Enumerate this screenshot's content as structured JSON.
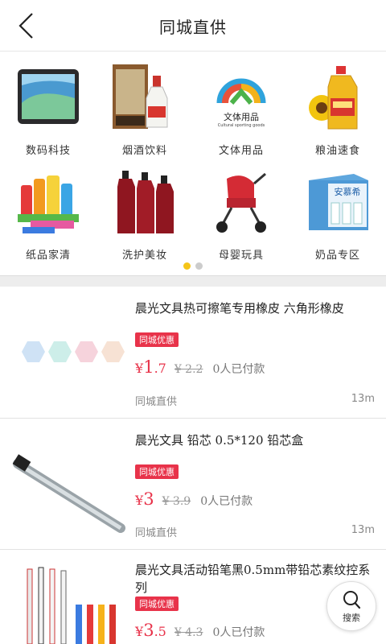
{
  "header": {
    "title": "同城直供",
    "back_icon": "chevron-left-icon"
  },
  "categories": [
    {
      "label": "数码科技",
      "icon": "smartphone-image"
    },
    {
      "label": "烟酒饮料",
      "icon": "liquor-bottle-image"
    },
    {
      "label": "文体用品",
      "icon": "stationery-logo-image",
      "logo_text": "文体用品",
      "logo_sub": "Cultural sporting goods"
    },
    {
      "label": "粮油速食",
      "icon": "cooking-oil-image"
    },
    {
      "label": "纸品家清",
      "icon": "cleaning-supplies-image"
    },
    {
      "label": "洗护美妆",
      "icon": "shampoo-bottles-image"
    },
    {
      "label": "母婴玩具",
      "icon": "baby-stroller-image"
    },
    {
      "label": "奶品专区",
      "icon": "milk-box-image",
      "box_text": "安慕希"
    }
  ],
  "pager": {
    "pages": 2,
    "active": 1,
    "active_color": "#f5c518"
  },
  "products": [
    {
      "title": "晨光文具热可擦笔专用橡皮 六角形橡皮",
      "badge": "同城优惠",
      "price_currency": "¥",
      "price_int": "1",
      "price_dec": ".7",
      "old_price": "¥ 2.2",
      "paid": "0人已付款",
      "shop": "同城直供",
      "distance": "13m",
      "image": "hexagon-erasers-image"
    },
    {
      "title": "晨光文具 铅芯 0.5*120 铅芯盒",
      "badge": "同城优惠",
      "price_currency": "¥",
      "price_int": "3",
      "price_dec": "",
      "old_price": "¥ 3.9",
      "paid": "0人已付款",
      "shop": "同城直供",
      "distance": "13m",
      "image": "pencil-lead-tube-image"
    },
    {
      "title": "晨光文具活动铅笔黑0.5mm带铅芯素纹控系列",
      "badge": "同城优惠",
      "price_currency": "¥",
      "price_int": "3",
      "price_dec": ".5",
      "old_price": "¥ 4.3",
      "paid": "0人已付款",
      "image": "mechanical-pencils-image"
    }
  ],
  "search_button": {
    "label": "搜索",
    "icon": "search-icon"
  },
  "colors": {
    "accent": "#e8334a",
    "divider": "#ededed"
  }
}
